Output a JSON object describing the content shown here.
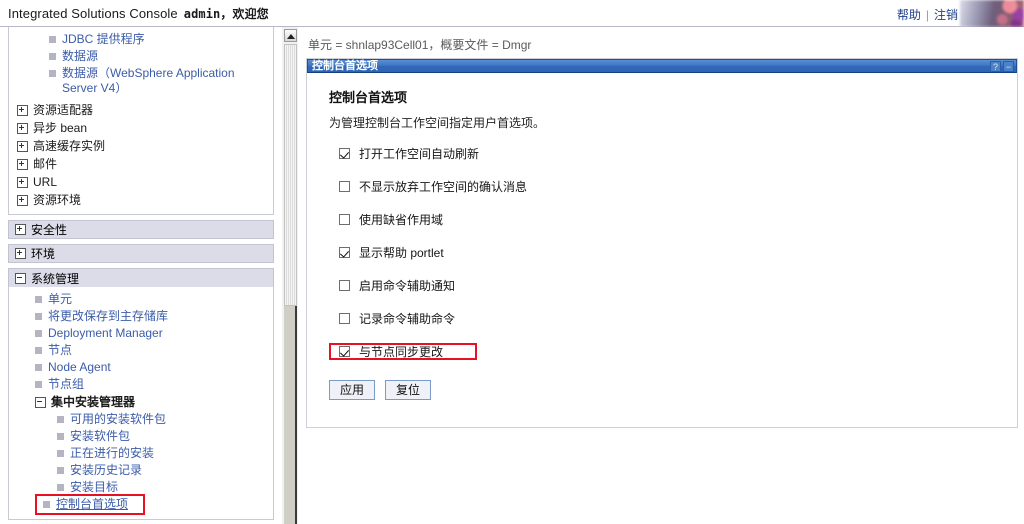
{
  "header": {
    "product_title": "Integrated Solutions Console",
    "user": "admin",
    "welcome": "，欢迎您",
    "help_link": "帮助",
    "separator": "|",
    "logout_link": "注销"
  },
  "sidebar": {
    "resources_group": [
      {
        "label": "JDBC 提供程序",
        "type": "leaf",
        "indent": 2
      },
      {
        "label": "数据源",
        "type": "leaf",
        "indent": 2
      },
      {
        "label": "数据源（WebSphere Application Server V4）",
        "type": "leaf",
        "indent": 2
      },
      {
        "label": "资源适配器",
        "type": "node",
        "expanded": false,
        "indent": 0
      },
      {
        "label": "异步 bean",
        "type": "node",
        "expanded": false,
        "indent": 0
      },
      {
        "label": "高速缓存实例",
        "type": "node",
        "expanded": false,
        "indent": 0
      },
      {
        "label": "邮件",
        "type": "node",
        "expanded": false,
        "indent": 0
      },
      {
        "label": "URL",
        "type": "node",
        "expanded": false,
        "indent": 0
      },
      {
        "label": "资源环境",
        "type": "node",
        "expanded": false,
        "indent": 0
      }
    ],
    "categories": [
      {
        "label": "安全性",
        "expanded": false
      },
      {
        "label": "环境",
        "expanded": false
      },
      {
        "label": "系统管理",
        "expanded": true
      }
    ],
    "system_admin_items": [
      {
        "label": "单元",
        "type": "leaf"
      },
      {
        "label": "将更改保存到主存储库",
        "type": "leaf"
      },
      {
        "label": "Deployment Manager",
        "type": "leaf"
      },
      {
        "label": "节点",
        "type": "leaf"
      },
      {
        "label": "Node Agent",
        "type": "leaf"
      },
      {
        "label": "节点组",
        "type": "leaf"
      }
    ],
    "install_group": {
      "label": "集中安装管理器",
      "expanded": true,
      "items": [
        {
          "label": "可用的安装软件包",
          "selected": false
        },
        {
          "label": "安装软件包",
          "selected": false
        },
        {
          "label": "正在进行的安装",
          "selected": false
        },
        {
          "label": "安装历史记录",
          "selected": false
        },
        {
          "label": "安装目标",
          "selected": false
        },
        {
          "label": "控制台首选项",
          "selected": true
        }
      ]
    }
  },
  "main": {
    "breadcrumb": "单元 = shnlap93Cell01，概要文件 = Dmgr",
    "portlet": {
      "title": "控制台首选项",
      "help_icon": "?",
      "minimize_icon": "−",
      "section_title": "控制台首选项",
      "section_desc": "为管理控制台工作空间指定用户首选项。",
      "checkboxes": [
        {
          "label": "打开工作空间自动刷新",
          "checked": true,
          "highlighted": false
        },
        {
          "label": "不显示放弃工作空间的确认消息",
          "checked": false,
          "highlighted": false
        },
        {
          "label": "使用缺省作用域",
          "checked": false,
          "highlighted": false
        },
        {
          "label": "显示帮助 portlet",
          "checked": true,
          "highlighted": false
        },
        {
          "label": "启用命令辅助通知",
          "checked": false,
          "highlighted": false
        },
        {
          "label": "记录命令辅助命令",
          "checked": false,
          "highlighted": false
        },
        {
          "label": "与节点同步更改",
          "checked": true,
          "highlighted": true
        }
      ],
      "apply_button": "应用",
      "reset_button": "复位"
    }
  },
  "colors": {
    "accent_blue": "#3069ba",
    "link_blue": "#3b5ca8",
    "category_bg": "#dcdce9",
    "highlight_red": "#e81123"
  }
}
